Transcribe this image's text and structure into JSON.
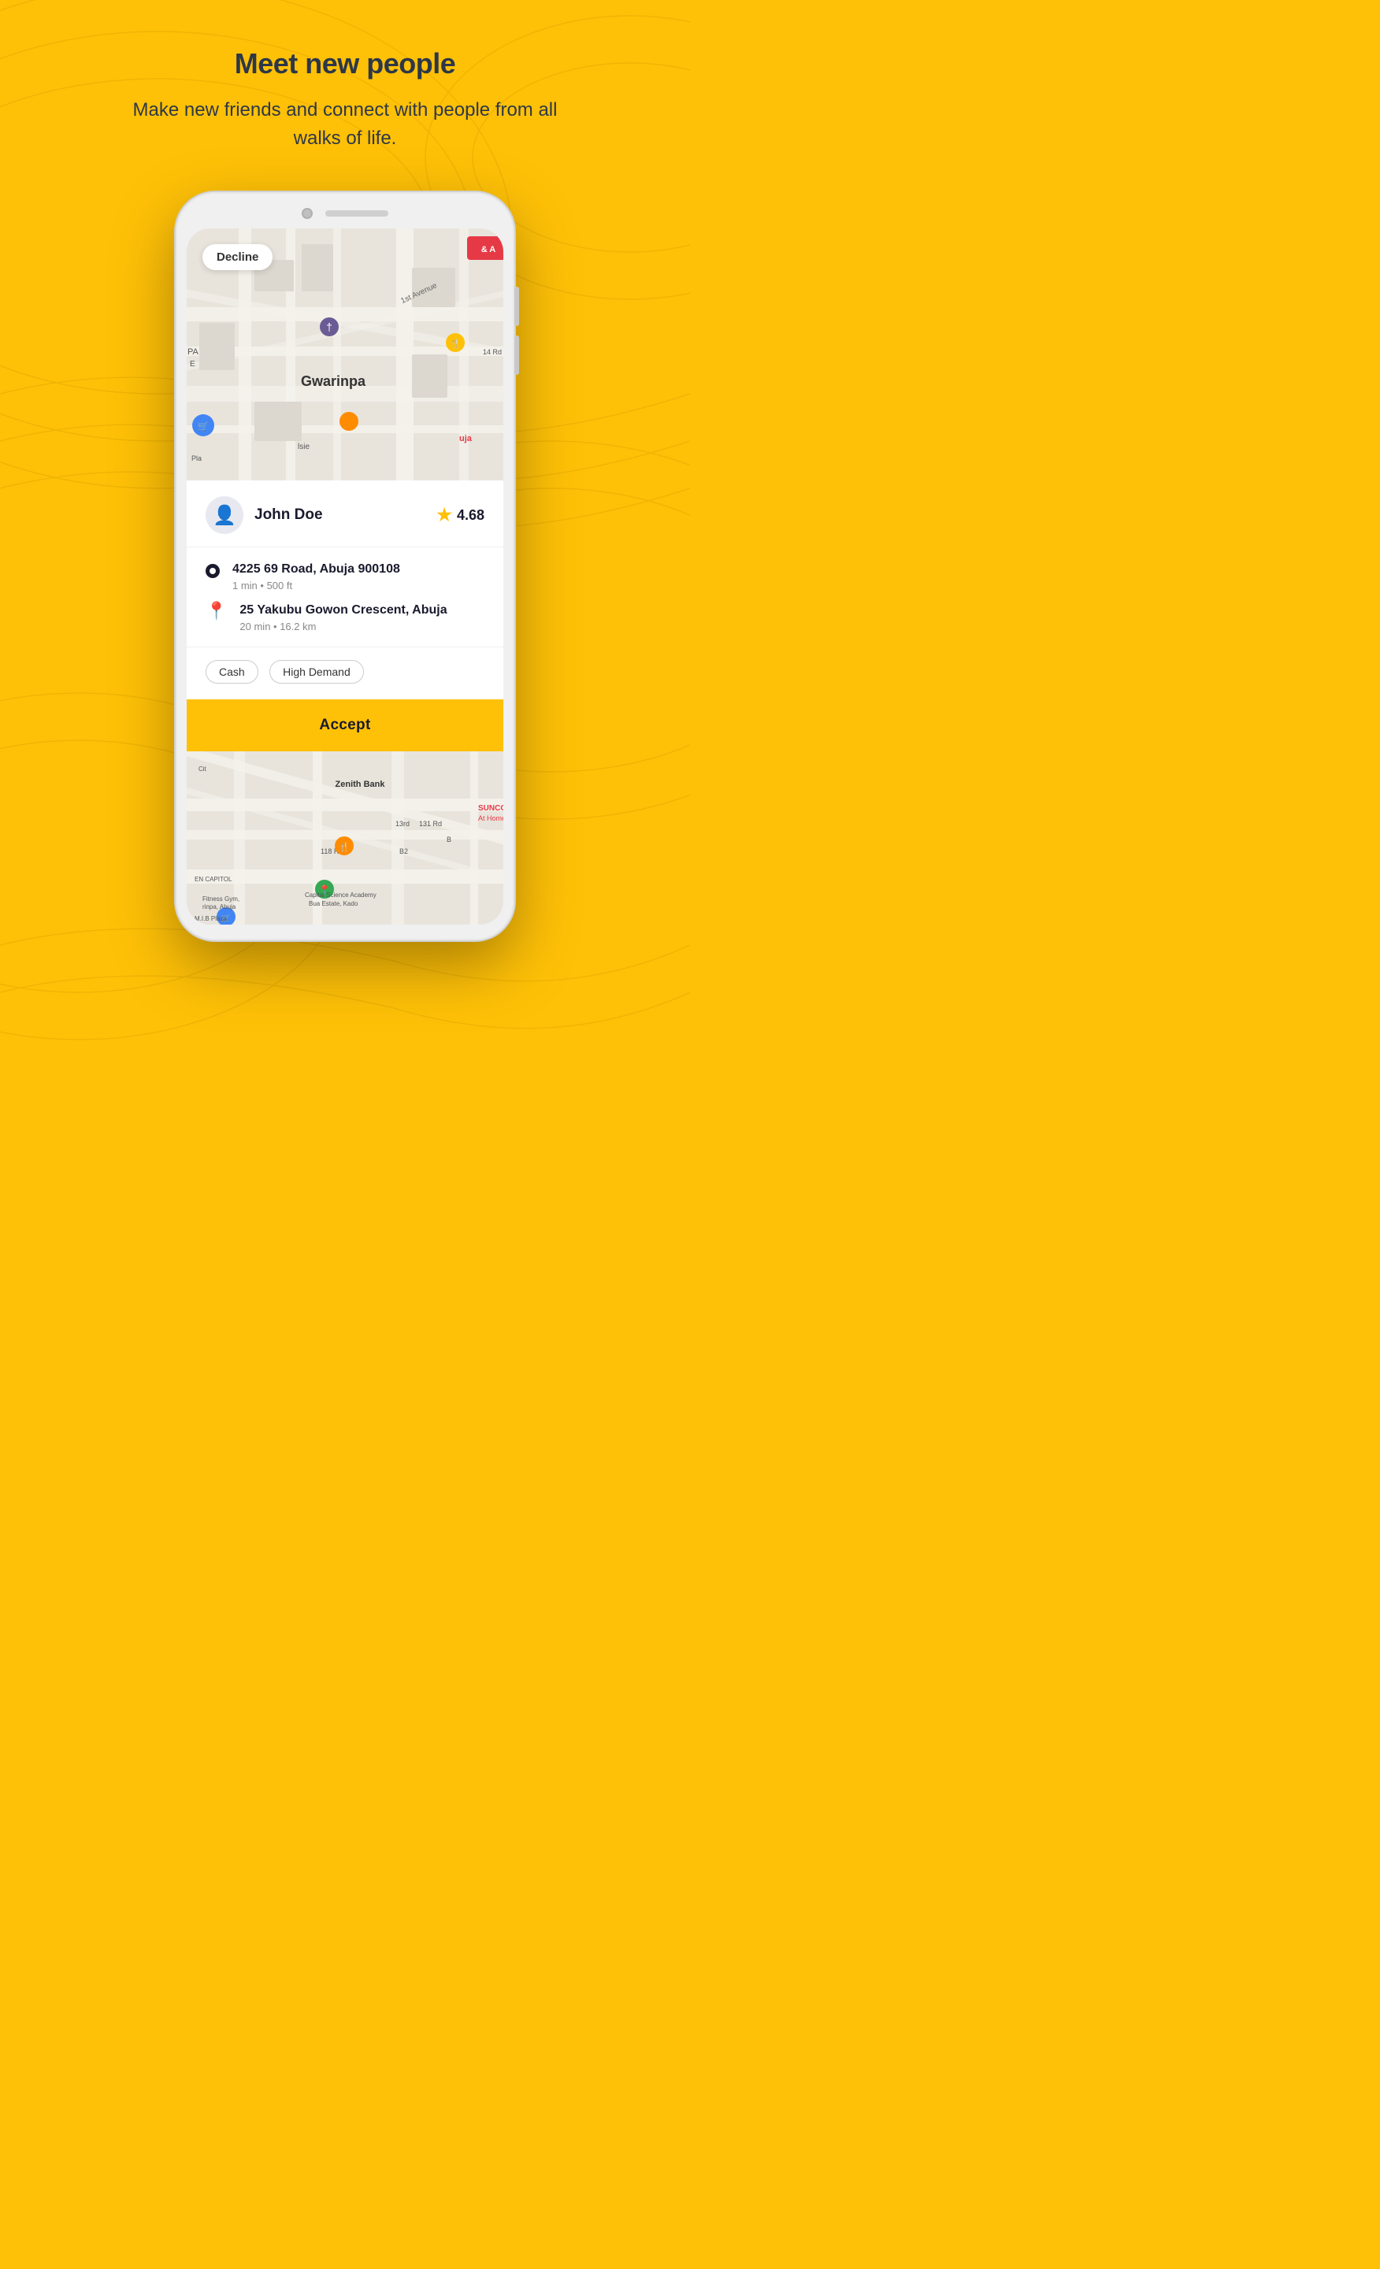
{
  "page": {
    "background_color": "#FFC107"
  },
  "header": {
    "title": "Meet new people",
    "subtitle": "Make new friends and connect with people from all walks of life."
  },
  "phone": {
    "map_area": {
      "location_label": "Gwarinpa"
    },
    "decline_button": "Decline",
    "ride_card": {
      "rider": {
        "name": "John Doe",
        "rating": "4.68"
      },
      "pickup": {
        "address": "4225 69 Road, Abuja 900108",
        "meta": "1 min • 500 ft"
      },
      "dropoff": {
        "address": "25 Yakubu Gowon Crescent, Abuja",
        "meta": "20 min • 16.2 km"
      },
      "tags": [
        "Cash",
        "High Demand"
      ],
      "accept_button": "Accept"
    }
  }
}
